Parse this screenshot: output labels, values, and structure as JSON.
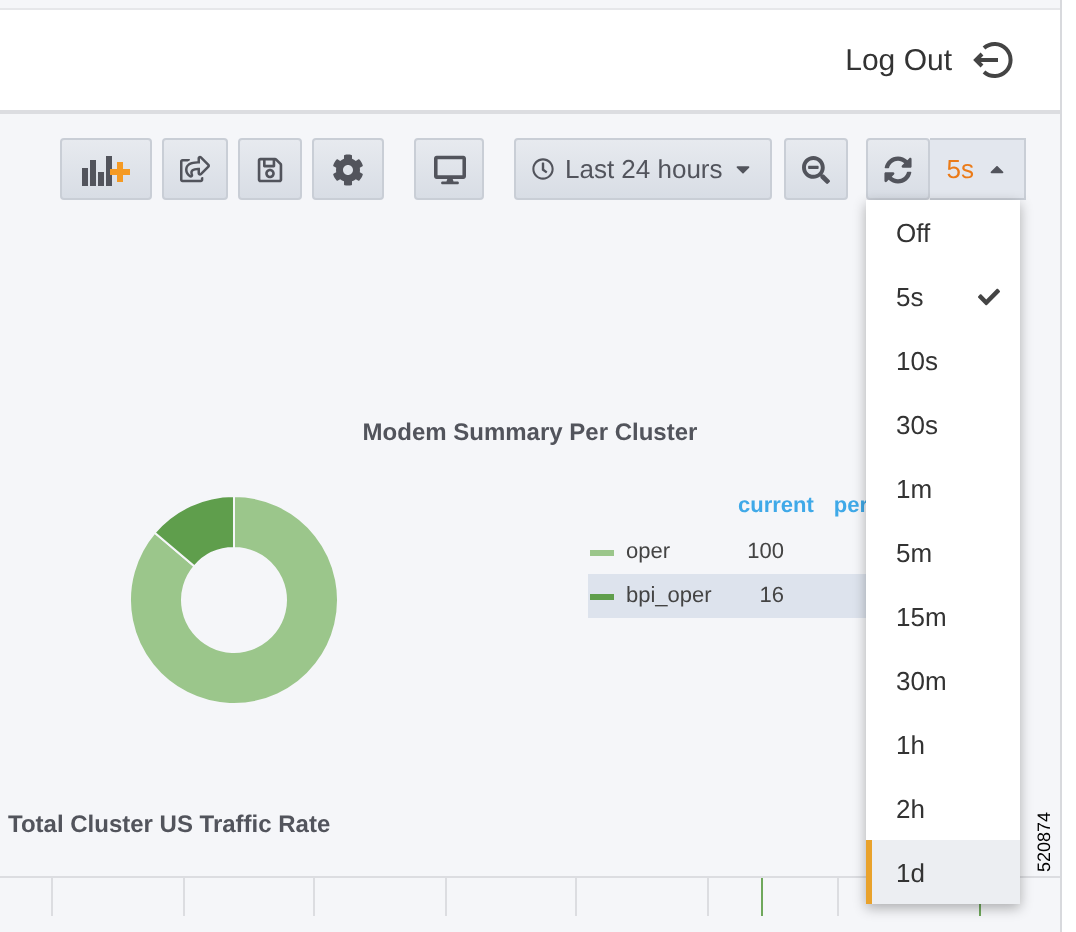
{
  "header": {
    "logout_label": "Log Out"
  },
  "toolbar": {
    "time_range": "Last 24 hours",
    "refresh_interval": "5s"
  },
  "refresh_menu": [
    {
      "label": "Off",
      "checked": false,
      "hovered": false
    },
    {
      "label": "5s",
      "checked": true,
      "hovered": false
    },
    {
      "label": "10s",
      "checked": false,
      "hovered": false
    },
    {
      "label": "30s",
      "checked": false,
      "hovered": false
    },
    {
      "label": "1m",
      "checked": false,
      "hovered": false
    },
    {
      "label": "5m",
      "checked": false,
      "hovered": false
    },
    {
      "label": "15m",
      "checked": false,
      "hovered": false
    },
    {
      "label": "30m",
      "checked": false,
      "hovered": false
    },
    {
      "label": "1h",
      "checked": false,
      "hovered": false
    },
    {
      "label": "2h",
      "checked": false,
      "hovered": false
    },
    {
      "label": "1d",
      "checked": false,
      "hovered": true
    }
  ],
  "panels": [
    {
      "title": "Modem Summary Per Cluster",
      "legend": {
        "columns": [
          "current",
          "per"
        ],
        "rows": [
          {
            "name": "oper",
            "current": "100",
            "color": "#9bc68b",
            "selected": false
          },
          {
            "name": "bpi_oper",
            "current": "16",
            "color": "#5f9e4c",
            "selected": true
          }
        ]
      }
    },
    {
      "title": "Total Cluster US Traffic Rate"
    }
  ],
  "figure_id": "520874"
}
